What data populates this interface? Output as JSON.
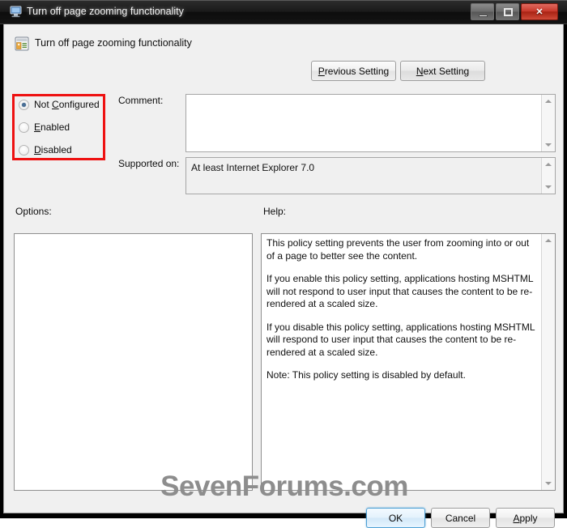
{
  "window": {
    "title": "Turn off page zooming functionality",
    "title_icon": "policy-monitor-icon",
    "controls": {
      "minimize": "minimize-icon",
      "maximize": "restore-icon",
      "close": "✕"
    }
  },
  "header": {
    "icon": "policy-setting-icon",
    "title": "Turn off page zooming functionality",
    "previous_setting_label": "Previous Setting",
    "previous_setting_accel": "P",
    "next_setting_label": "Next Setting",
    "next_setting_accel": "N"
  },
  "state": {
    "options": [
      {
        "id": "not-configured",
        "label_pre": "Not ",
        "accel": "C",
        "label_post": "onfigured",
        "selected": true
      },
      {
        "id": "enabled",
        "label_pre": "",
        "accel": "E",
        "label_post": "nabled",
        "selected": false
      },
      {
        "id": "disabled",
        "label_pre": "",
        "accel": "D",
        "label_post": "isabled",
        "selected": false
      }
    ],
    "highlight_color": "#ee1111"
  },
  "fields": {
    "comment_label": "Comment:",
    "comment_value": "",
    "comment_placeholder": "",
    "supported_label": "Supported on:",
    "supported_value": "At least Internet Explorer 7.0"
  },
  "panels": {
    "options_label": "Options:",
    "options_content": "",
    "help_label": "Help:",
    "help_paragraphs": [
      "This policy setting prevents the user from zooming into or out of a page to better see the content.",
      "If you enable this policy setting, applications hosting MSHTML will not respond to user input that causes the content to be re-rendered at a scaled size.",
      "If you disable this policy setting, applications hosting MSHTML will respond to user input that causes the content to be re-rendered at a scaled size.",
      "Note: This policy setting is disabled by default."
    ]
  },
  "watermark": "SevenForums.com",
  "footer": {
    "ok_label": "OK",
    "cancel_label": "Cancel",
    "apply_label": "Apply",
    "apply_accel": "A"
  }
}
